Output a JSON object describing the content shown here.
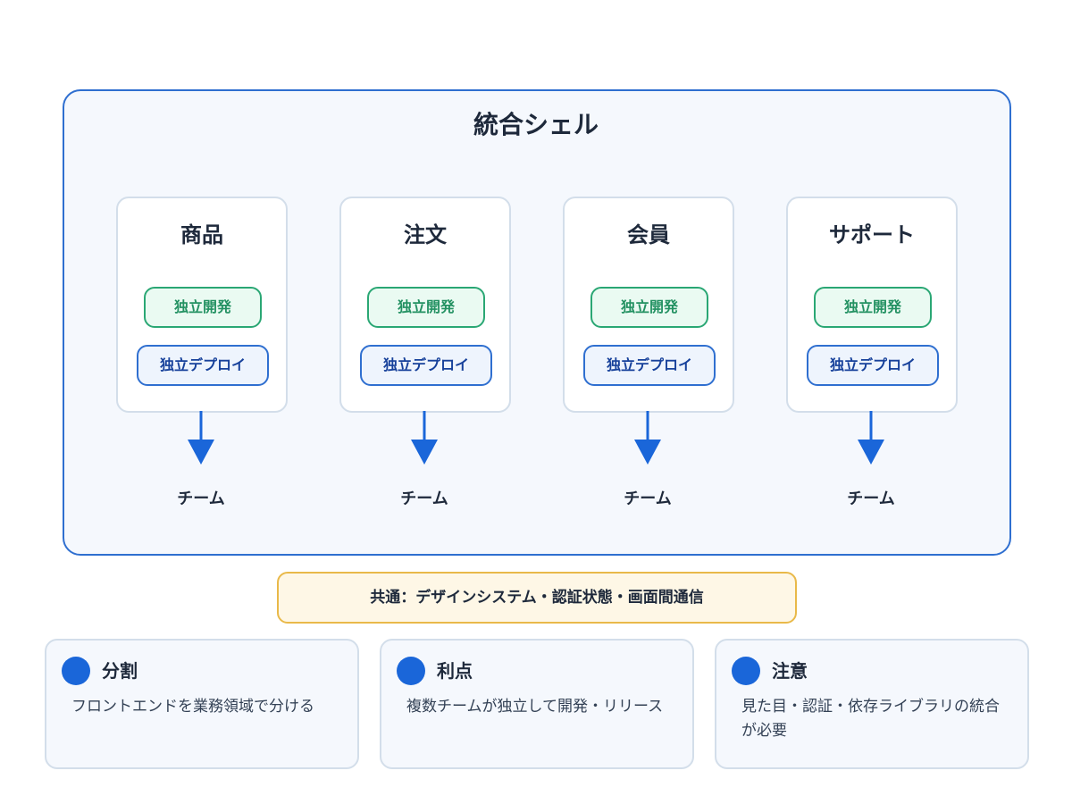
{
  "shell": {
    "title": "統合シェル"
  },
  "micro_frontends": [
    {
      "title": "商品",
      "dev_label": "独立開発",
      "deploy_label": "独立デプロイ",
      "team_label": "チーム"
    },
    {
      "title": "注文",
      "dev_label": "独立開発",
      "deploy_label": "独立デプロイ",
      "team_label": "チーム"
    },
    {
      "title": "会員",
      "dev_label": "独立開発",
      "deploy_label": "独立デプロイ",
      "team_label": "チーム"
    },
    {
      "title": "サポート",
      "dev_label": "独立開発",
      "deploy_label": "独立デプロイ",
      "team_label": "チーム"
    }
  ],
  "common": {
    "label": "共通：デザインシステム・認証状態・画面間通信"
  },
  "cards": [
    {
      "title": "分割",
      "text": "フロントエンドを業務領域で分ける"
    },
    {
      "title": "利点",
      "text": "複数チームが独立して開発・リリース"
    },
    {
      "title": "注意",
      "text": "見た目・認証・依存ライブラリの統合が必要"
    }
  ],
  "colors": {
    "shell_border": "#2f6fd0",
    "dev_green": "#2aa774",
    "deploy_blue": "#2f6fd0",
    "arrow_blue": "#1a66d9",
    "common_amber": "#e9b949",
    "dot_blue": "#1a66d9"
  },
  "icons": {
    "arrow": "arrow-down-icon",
    "dot": "bullet-dot-icon"
  }
}
